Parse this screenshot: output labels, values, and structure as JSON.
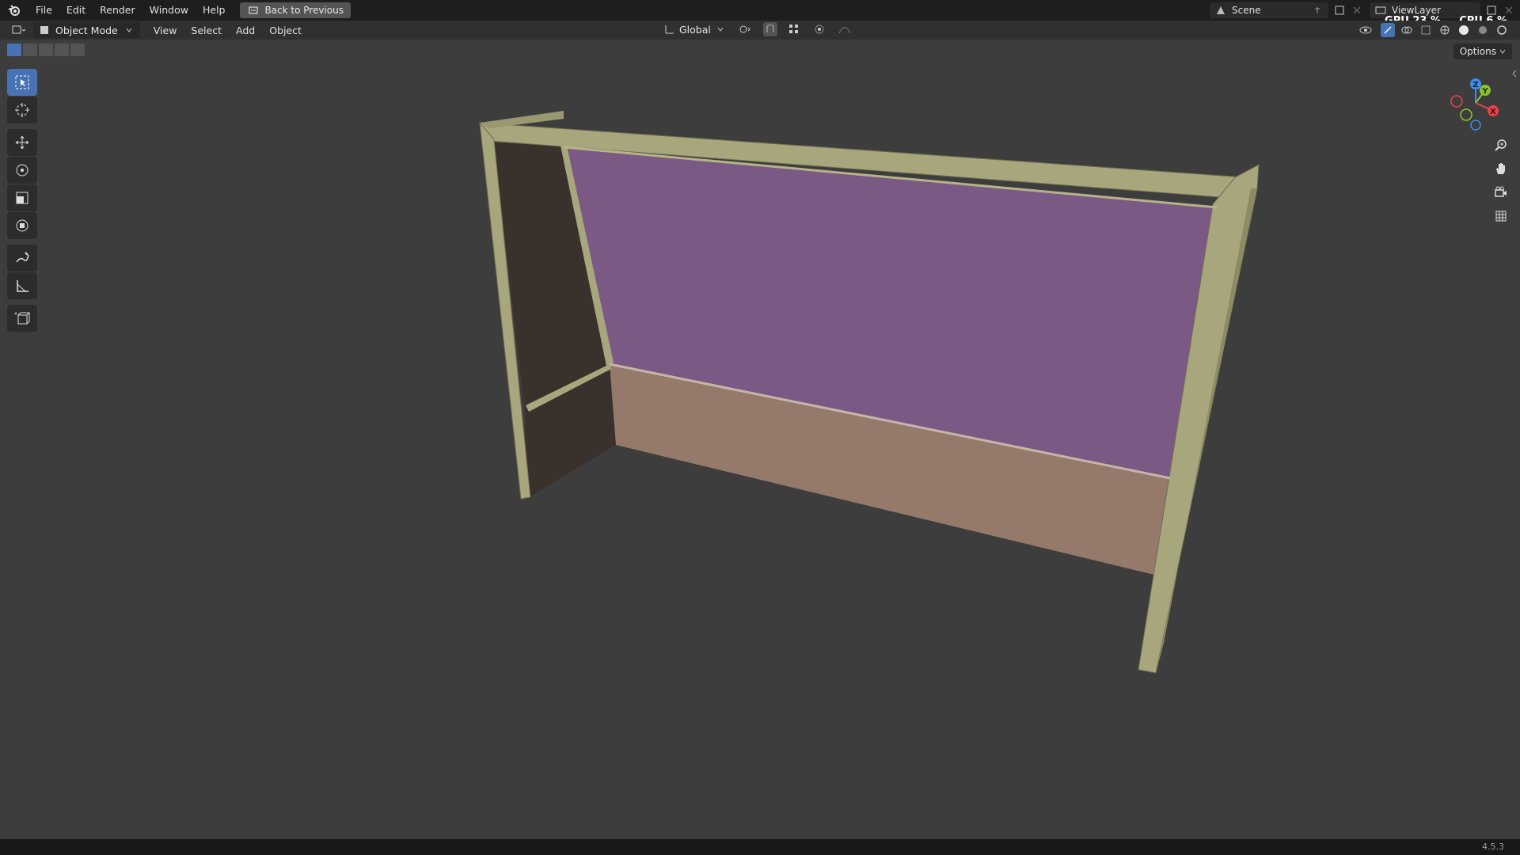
{
  "menubar": {
    "items": [
      "File",
      "Edit",
      "Render",
      "Window",
      "Help"
    ],
    "back_button": "Back to Previous",
    "scene": "Scene",
    "view_layer": "ViewLayer",
    "gpu_label": "GPU",
    "gpu_value": "23 %",
    "cpu_label": "CPU",
    "cpu_value": "6 %"
  },
  "header": {
    "mode": "Object Mode",
    "menus": [
      "View",
      "Select",
      "Add",
      "Object"
    ],
    "transform_orientation": "Global",
    "options": "Options"
  },
  "toolbar": {
    "tools": [
      "select-box",
      "cursor",
      "move",
      "rotate",
      "scale",
      "transform",
      "annotate",
      "measure",
      "add-cube"
    ],
    "active_tool": "select-box"
  },
  "gizmo": {
    "axes": [
      "Z",
      "Y",
      "X"
    ],
    "colors": {
      "x": "#e8434d",
      "y": "#8ec22c",
      "z": "#3a8ee8"
    }
  },
  "object": {
    "frame_color": "#9e9c70",
    "panel_color": "#7a5a84",
    "base_color": "#957a6c",
    "side_color": "#3f3430"
  },
  "statusbar": {
    "version": "4.5.3"
  }
}
